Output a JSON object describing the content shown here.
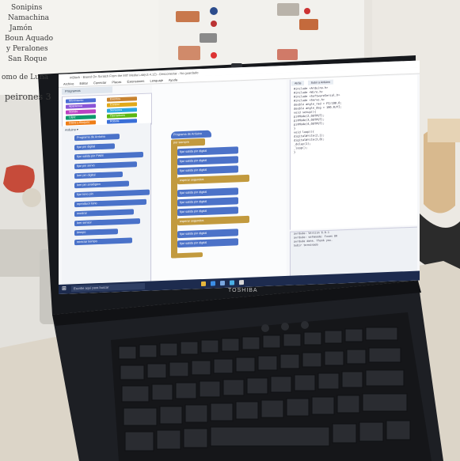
{
  "poster": {
    "left_lines": [
      "Sonipins",
      "Namachina",
      "Jamón",
      "Boun Aquado",
      "y Peralones",
      "San Roque",
      "omo de Luna"
    ],
    "bottom_line": "peirones 3"
  },
  "laptop": {
    "brand": "TOSHIBA"
  },
  "app": {
    "title": "mBlock - Based On Scratch From the MIT Media Lab(v3.4.12) - Desconectar - No guardado",
    "menu": [
      "Archivo",
      "Editar",
      "Conectar",
      "Placas",
      "Extensiones",
      "Lenguaje",
      "Ayuda"
    ],
    "tab": "Programas",
    "categories_left": [
      "Movimiento",
      "Apariencia",
      "Sonido",
      "Lápiz",
      "Datos y Bloques"
    ],
    "categories_right": [
      "Eventos",
      "Control",
      "Sensores",
      "Operadores",
      "Robots"
    ],
    "palette_head": "Arduino ▾",
    "palette_blocks": [
      "Programa de Arduino",
      "fijar pin digital",
      "fijar salida pin PWM",
      "fijar pin servo",
      "leer pin digital",
      "leer pin analógico",
      "fijar tono pin",
      "reproducir tono",
      "mostrar",
      "leer sensor",
      "tiempo",
      "reiniciar tiempo"
    ],
    "workspace_blocks": [
      "Programa de Arduino",
      "por siempre",
      "fijar salida pin digital",
      "fijar salida pin digital",
      "fijar salida pin digital",
      "esperar segundos",
      "fijar salida pin digital",
      "fijar salida pin digital",
      "fijar salida pin digital",
      "esperar segundos",
      "fijar salida pin digital",
      "fijar salida pin digital"
    ],
    "code_tabs": [
      "Atrás",
      "Subir a Arduino"
    ],
    "code_lines": [
      "#include <Arduino.h>",
      "#include <Wire.h>",
      "#include <SoftwareSerial.h>",
      "",
      "#include <Servo.h>",
      "",
      "double angle_rad = PI/180.0;",
      "double angle_deg = 180.0/PI;",
      "",
      "void setup(){",
      "  pinMode(2,OUTPUT);",
      "  pinMode(3,OUTPUT);",
      "  pinMode(4,OUTPUT);",
      "}",
      "",
      "void loop(){",
      "  digitalWrite(2,1);",
      "  digitalWrite(3,0);",
      "  _delay(1);",
      "  _loop();",
      "}"
    ],
    "console_lines": [
      "avrdude: Version 6.0.1",
      "avrdude: safemode: Fuses OK",
      "",
      "avrdude done.  Thank you.",
      "",
      "Subir terminado"
    ],
    "search_placeholder": "Escribe aquí para buscar"
  }
}
